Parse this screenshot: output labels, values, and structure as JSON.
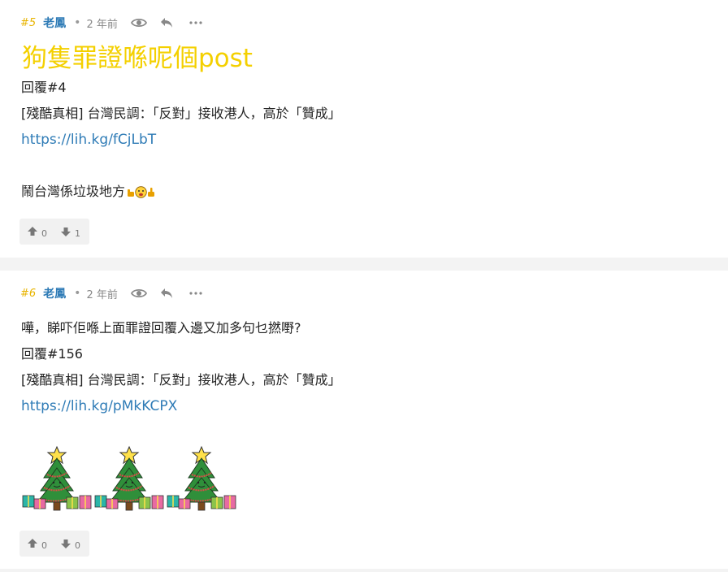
{
  "posts": [
    {
      "floor": "#5",
      "author": "老鳳",
      "separator": "•",
      "time": "2 年前",
      "title": "狗隻罪證喺呢個post",
      "lines": [
        "回覆#4",
        "[殘酷真相] 台灣民調：「反對」接收港人，高於「贊成」"
      ],
      "link": "https://lih.kg/fCjLbT",
      "body": "鬧台灣係垃圾地方",
      "upvotes": "0",
      "downvotes": "1"
    },
    {
      "floor": "#6",
      "author": "老鳳",
      "separator": "•",
      "time": "2 年前",
      "lines": [
        "嘩，睇吓佢喺上面罪證回覆入邊又加多句乜撚嘢?",
        "回覆#156",
        "[殘酷真相] 台灣民調：「反對」接收港人，高於「贊成」"
      ],
      "link": "https://lih.kg/pMkKCPX",
      "upvotes": "0",
      "downvotes": "0"
    }
  ],
  "colors": {
    "floor": "#e8b400",
    "author": "#2e7bb6",
    "title": "#f4d000",
    "link": "#2e7bb6",
    "divider": "#f3f3f3"
  },
  "icons": [
    "eye-icon",
    "reply-icon",
    "more-icon",
    "thumbs-up-icon",
    "thumbs-down-icon"
  ]
}
